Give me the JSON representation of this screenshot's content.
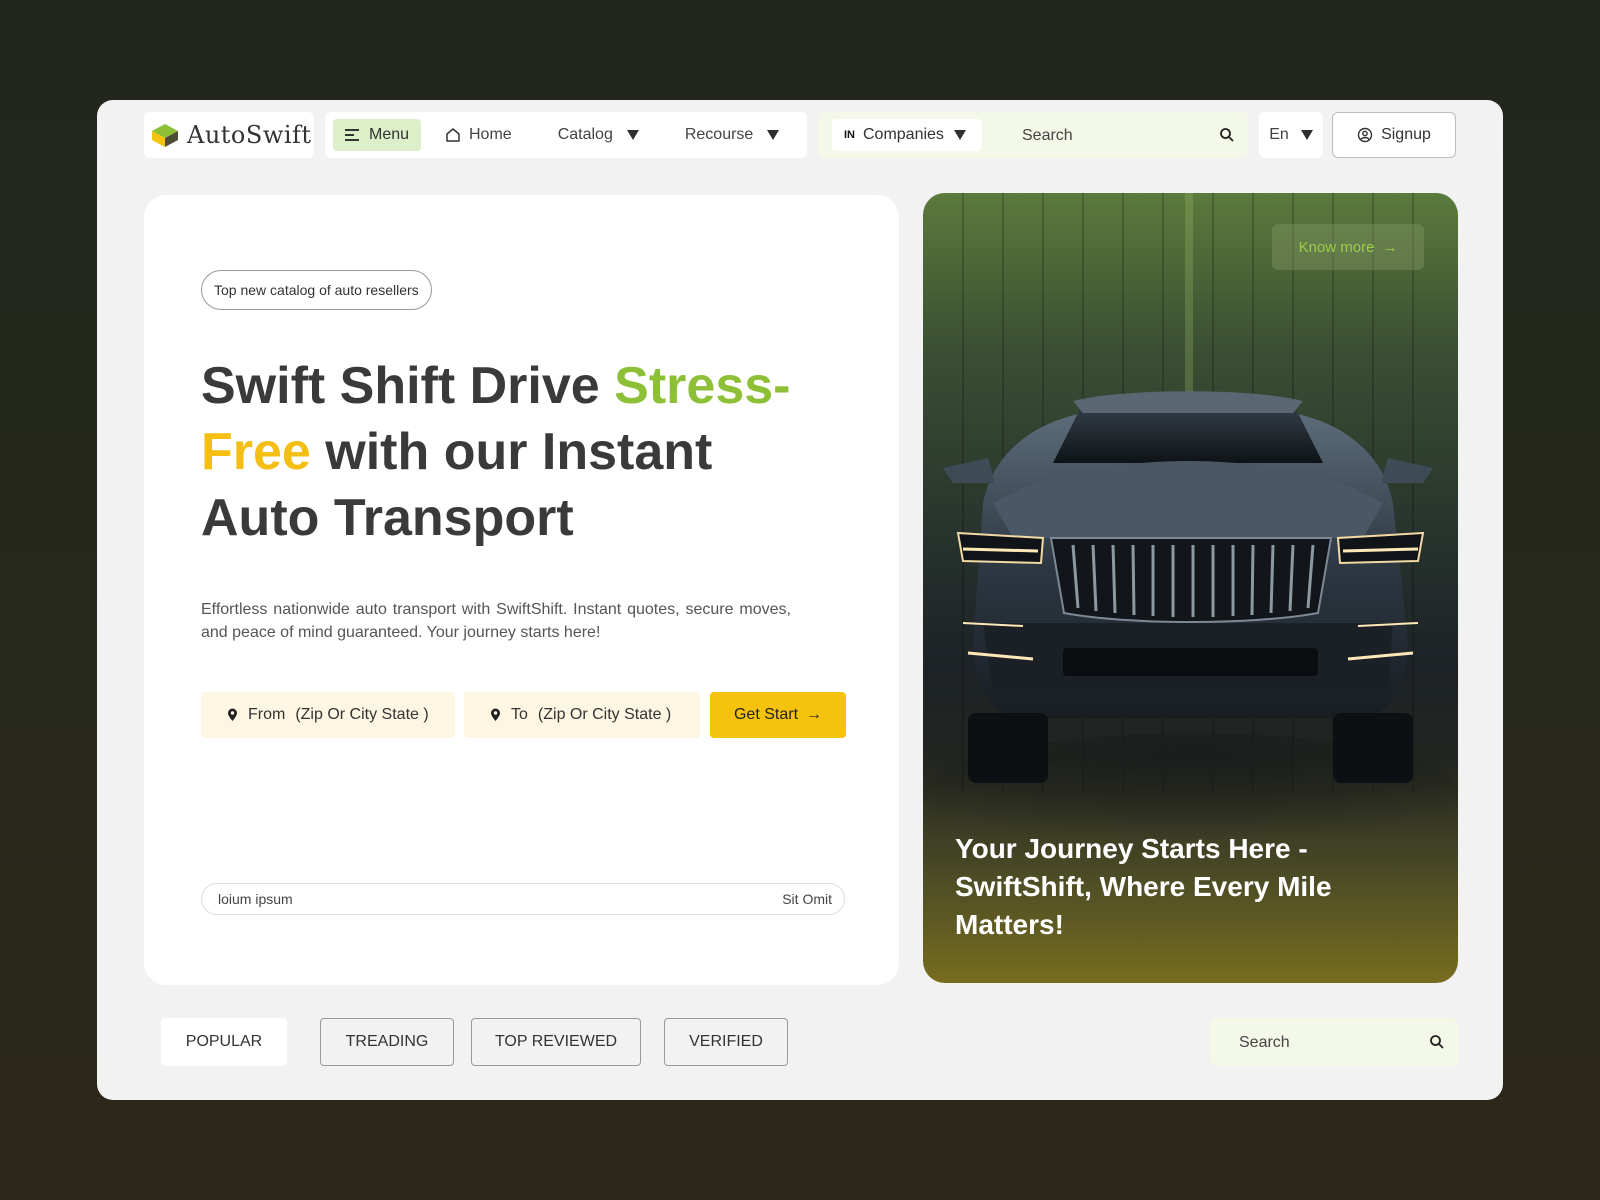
{
  "brand": {
    "name": "AutoSwift"
  },
  "nav": {
    "menu_label": "Menu",
    "home_label": "Home",
    "catalog_label": "Catalog",
    "resource_label": "Recourse"
  },
  "search_bar": {
    "country_code": "IN",
    "scope_label": "Companies",
    "placeholder": "Search"
  },
  "language": {
    "selected": "En"
  },
  "signup_label": "Signup",
  "hero": {
    "tag": "Top new catalog of auto resellers",
    "headline": {
      "part1": "Swift Shift Drive ",
      "green": "Stress-",
      "yellow": "Free",
      "part2": " with our Instant Auto Transport"
    },
    "description": "Effortless nationwide auto transport with SwiftShift. Instant quotes, secure moves, and peace of mind guaranteed. Your journey starts here!",
    "from_label": "From",
    "from_hint": "(Zip Or City State )",
    "to_label": "To",
    "to_hint": "(Zip Or City State )",
    "cta_label": "Get Start",
    "cta_arrow": "→",
    "footer_left": "loium ipsum",
    "footer_right": "Sit Omit"
  },
  "promo": {
    "know_more_label": "Know more",
    "know_more_arrow": "→",
    "caption": "Your Journey Starts Here - SwiftShift, Where Every Mile Matters!"
  },
  "filters": {
    "tabs": [
      {
        "label": "POPULAR",
        "active": true
      },
      {
        "label": "TREADING",
        "active": false
      },
      {
        "label": "TOP REVIEWED",
        "active": false
      },
      {
        "label": "VERIFIED",
        "active": false
      }
    ],
    "search_placeholder": "Search"
  },
  "colors": {
    "accent_green": "#8dbf37",
    "accent_yellow": "#f5c20e",
    "menu_bg": "#dcefc8",
    "input_bg": "#fdf6e3",
    "search_bg": "#f3f8e8"
  }
}
